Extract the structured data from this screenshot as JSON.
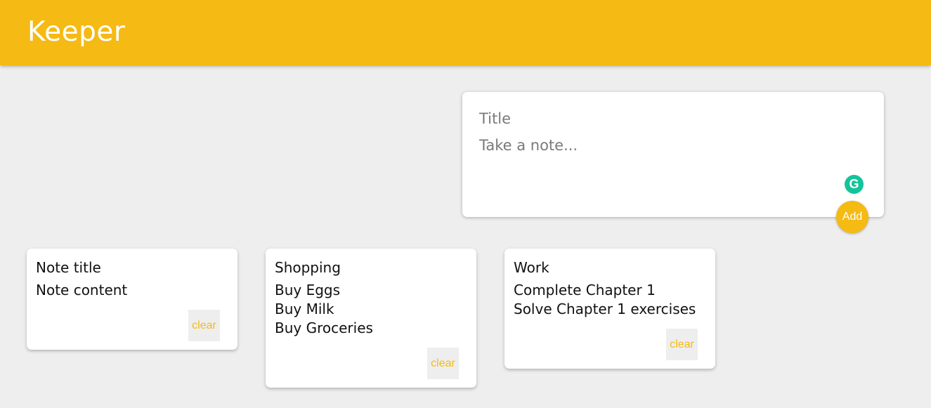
{
  "header": {
    "title": "Keeper"
  },
  "compose": {
    "title_placeholder": "Title",
    "content_placeholder": "Take a note...",
    "grammarly_glyph": "G",
    "add_label": "Add"
  },
  "notes": [
    {
      "title": "Note title",
      "lines": [
        "Note content"
      ],
      "clear_label": "clear"
    },
    {
      "title": "Shopping",
      "lines": [
        "Buy Eggs",
        "Buy Milk",
        "Buy Groceries"
      ],
      "clear_label": "clear"
    },
    {
      "title": "Work",
      "lines": [
        "Complete Chapter 1",
        "Solve Chapter 1 exercises"
      ],
      "clear_label": "clear"
    }
  ],
  "colors": {
    "accent": "#f5ba13",
    "background": "#eeeeee",
    "card": "#ffffff",
    "grammarly": "#15c39a"
  },
  "icons": {
    "grammarly": "grammarly-icon"
  }
}
